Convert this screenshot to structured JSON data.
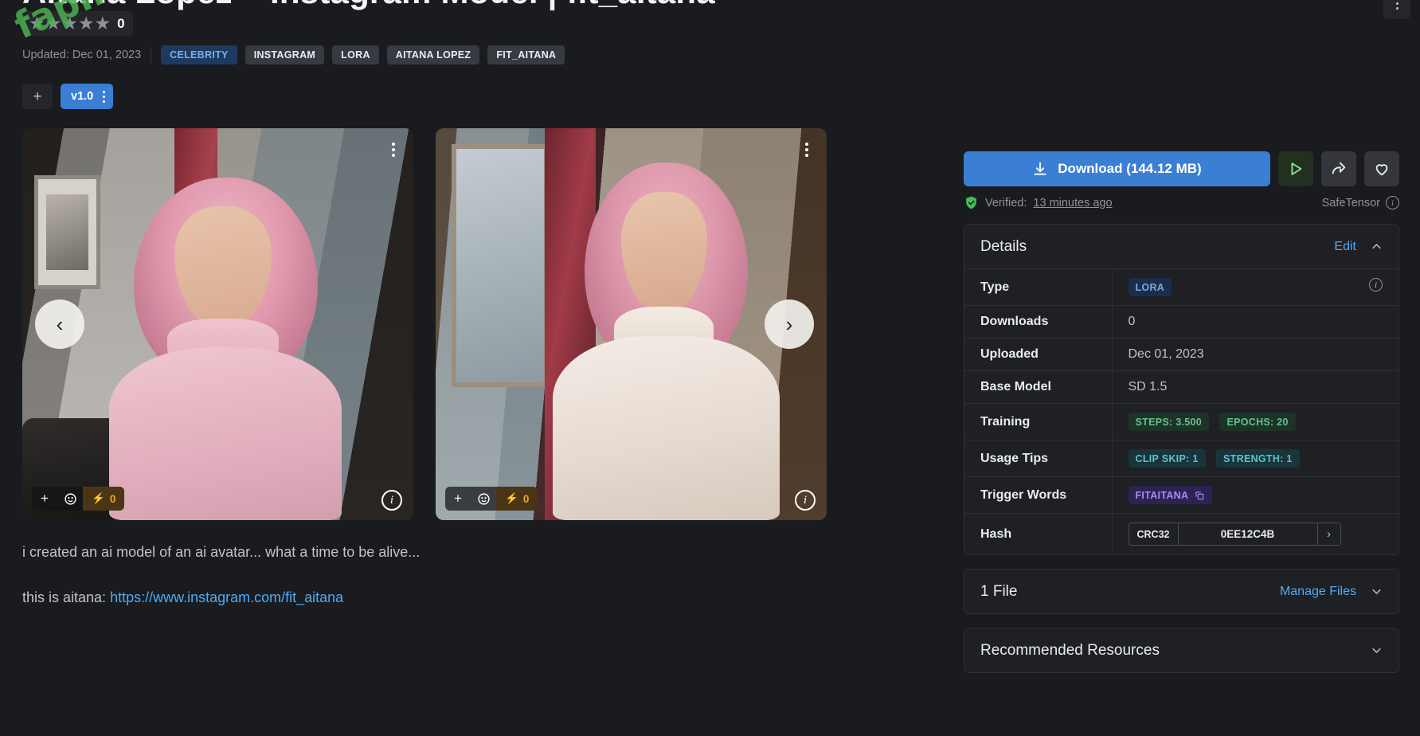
{
  "page": {
    "title_clipped": "Aitana Lopez – Instagram Model | fit_aitana",
    "watermark": "fapmenu.com"
  },
  "header": {
    "rating_stars": "★★★★★",
    "rating_count": "0",
    "updated": "Updated: Dec 01, 2023",
    "tags": [
      {
        "label": "CELEBRITY",
        "style": "blue"
      },
      {
        "label": "INSTAGRAM",
        "style": "grey"
      },
      {
        "label": "LORA",
        "style": "grey"
      },
      {
        "label": "AITANA LOPEZ",
        "style": "grey"
      },
      {
        "label": "FIT_AITANA",
        "style": "grey"
      }
    ],
    "add_version_label": "+",
    "version_label": "v1.0"
  },
  "gallery": {
    "prev_label": "‹",
    "next_label": "›",
    "images": [
      {
        "add_label": "+",
        "react_count": "0",
        "info_label": "i"
      },
      {
        "add_label": "+",
        "react_count": "0",
        "info_label": "i"
      }
    ]
  },
  "description": {
    "line1": "i created an ai model of an ai avatar... what a time to be alive...",
    "line2_prefix": "this is aitana: ",
    "link_text": "https://www.instagram.com/fit_aitana"
  },
  "actions": {
    "download_label": "Download (144.12 MB)",
    "verified_prefix": "Verified:",
    "verified_time": "13 minutes ago",
    "safetensor_label": "SafeTensor"
  },
  "details": {
    "heading": "Details",
    "edit_label": "Edit",
    "rows": [
      {
        "key": "Type",
        "value": "",
        "badges": [
          {
            "label": "LORA",
            "style": "lora"
          }
        ],
        "has_info": true
      },
      {
        "key": "Downloads",
        "value": "0",
        "badges": []
      },
      {
        "key": "Uploaded",
        "value": "Dec 01, 2023",
        "badges": []
      },
      {
        "key": "Base Model",
        "value": "SD 1.5",
        "badges": []
      },
      {
        "key": "Training",
        "value": "",
        "badges": [
          {
            "label": "STEPS: 3.500",
            "style": "green"
          },
          {
            "label": "EPOCHS: 20",
            "style": "green"
          }
        ]
      },
      {
        "key": "Usage Tips",
        "value": "",
        "badges": [
          {
            "label": "CLIP SKIP: 1",
            "style": "teal"
          },
          {
            "label": "STRENGTH: 1",
            "style": "teal"
          }
        ]
      },
      {
        "key": "Trigger Words",
        "value": "",
        "badges": [
          {
            "label": "FITAITANA",
            "style": "violet",
            "copy": true
          }
        ]
      }
    ],
    "hash": {
      "key": "Hash",
      "algo": "CRC32",
      "value": "0EE12C4B",
      "expand_label": "›"
    }
  },
  "files_panel": {
    "title": "1 File",
    "manage_label": "Manage Files"
  },
  "recommended_panel": {
    "title": "Recommended Resources"
  },
  "colors": {
    "accent_blue": "#3b7fd4",
    "link_blue": "#4dabf7",
    "bg": "#1a1b1e",
    "card_bg": "#1f2024",
    "verified_green": "#40c057",
    "react_orange": "#f5a524"
  }
}
